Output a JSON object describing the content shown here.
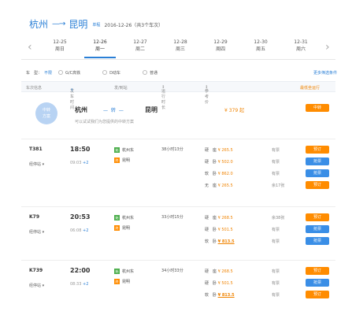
{
  "header": {
    "from": "杭州",
    "arrow": "—→",
    "to": "昆明",
    "tag": "单程",
    "date_info": "2016-12-26（共3个车次）"
  },
  "dates": [
    {
      "date": "12-25",
      "weekday": "周日"
    },
    {
      "date": "12-26",
      "weekday": "周一"
    },
    {
      "date": "12-27",
      "weekday": "周二"
    },
    {
      "date": "12-28",
      "weekday": "周三"
    },
    {
      "date": "12-29",
      "weekday": "周四"
    },
    {
      "date": "12-30",
      "weekday": "周五"
    },
    {
      "date": "12-31",
      "weekday": "周六"
    }
  ],
  "filters": {
    "type_label": "车　型：",
    "all": "不限",
    "gc": "G/C高铁",
    "d": "D动车",
    "normal": "普通",
    "more": "更多筛选条件"
  },
  "columns": {
    "train_no": "车次信息",
    "depart_time": "发车时间",
    "station": "发/到站",
    "duration": "运行时长",
    "price": "参考价",
    "cheapest": "最低坐运行"
  },
  "transfer": {
    "badge_l1": "中转",
    "badge_l2": "方案",
    "from": "杭州",
    "mid": "— 转 —",
    "to": "昆明",
    "price": "¥ 379 起",
    "note": "可以试试我们为您提供的中转方案",
    "button": "中转"
  },
  "trains": [
    {
      "no": "T381",
      "stop": "经停站",
      "depart": "18:50",
      "arrive": "09:03",
      "plus": "+2",
      "from_station": "杭州东",
      "to_station": "昆明",
      "duration": "38小时13分",
      "seats": [
        {
          "name": "硬　座",
          "price": "¥ 265.5",
          "avail": "有票",
          "btn": "预订",
          "btn_color": "orange"
        },
        {
          "name": "硬　卧",
          "price": "¥ 502.0",
          "avail": "有票",
          "btn": "抢票",
          "btn_color": "blue"
        },
        {
          "name": "软　卧",
          "price": "¥ 862.0",
          "avail": "有票",
          "btn": "抢票",
          "btn_color": "blue"
        },
        {
          "name": "无　座",
          "price": "¥ 265.5",
          "avail": "余17张",
          "btn": "预订",
          "btn_color": "orange"
        }
      ]
    },
    {
      "no": "K79",
      "stop": "经停站",
      "depart": "20:53",
      "arrive": "06:08",
      "plus": "+2",
      "from_station": "杭州东",
      "to_station": "昆明",
      "duration": "33小时15分",
      "seats": [
        {
          "name": "硬　座",
          "price": "¥ 268.5",
          "avail": "余38张",
          "btn": "预订",
          "btn_color": "orange"
        },
        {
          "name": "硬　卧",
          "price": "¥ 501.5",
          "avail": "有票",
          "btn": "抢票",
          "btn_color": "blue"
        },
        {
          "name": "软　卧",
          "price": "¥ 813.5",
          "avail": "有票",
          "btn": "抢票",
          "btn_color": "blue"
        }
      ]
    },
    {
      "no": "K739",
      "stop": "经停站",
      "depart": "22:00",
      "arrive": "08:33",
      "plus": "+2",
      "from_station": "杭州东",
      "to_station": "昆明",
      "duration": "34小时33分",
      "seats": [
        {
          "name": "硬　座",
          "price": "¥ 268.5",
          "avail": "有票",
          "btn": "预订",
          "btn_color": "orange"
        },
        {
          "name": "硬　卧",
          "price": "¥ 501.5",
          "avail": "有票",
          "btn": "抢票",
          "btn_color": "blue"
        },
        {
          "name": "软　卧",
          "price": "¥ 813.5",
          "avail": "有票",
          "btn": "预订",
          "btn_color": "orange"
        }
      ]
    }
  ]
}
